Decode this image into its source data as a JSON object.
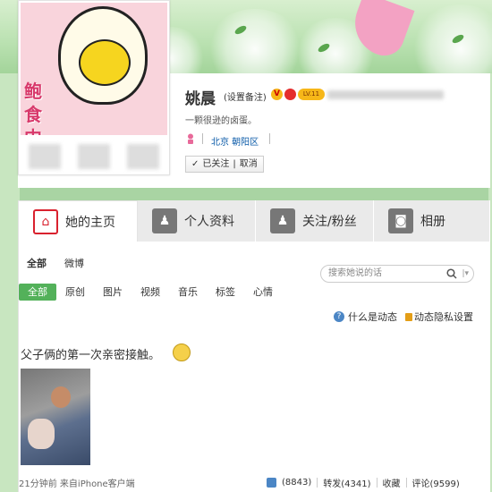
{
  "profile": {
    "name": "姚晨",
    "remark_link": "(设置备注)",
    "vip_badge": "V",
    "level_badge": "LV.11",
    "bio": "一颗很逊的卤蛋。",
    "location": "北京 朝阳区",
    "follow_status": "已关注",
    "cancel_follow": "取消",
    "avatar_text": "鲍食中"
  },
  "tabs": [
    {
      "label": "她的主页",
      "icon": "home-icon",
      "active": true
    },
    {
      "label": "个人资料",
      "icon": "user-icon",
      "active": false
    },
    {
      "label": "关注/粉丝",
      "icon": "users-icon",
      "active": false
    },
    {
      "label": "相册",
      "icon": "camera-icon",
      "active": false
    }
  ],
  "feed": {
    "filter_main": [
      "全部",
      "微博"
    ],
    "search_placeholder": "搜索她说的话",
    "subfilter": [
      "全部",
      "原创",
      "图片",
      "视频",
      "音乐",
      "标签",
      "心情"
    ],
    "help_link": "什么是动态",
    "privacy_link": "动态隐私设置"
  },
  "post": {
    "text": "父子俩的第一次亲密接触。",
    "time": "21分钟前",
    "source": "来自iPhone客户端",
    "like": "(8843)",
    "repost": "转发(4341)",
    "favorite": "收藏",
    "comment": "评论(9599)"
  },
  "colors": {
    "accent_green": "#53b15a",
    "link_blue": "#0a5aa8",
    "tab_active_red": "#d9212e"
  }
}
